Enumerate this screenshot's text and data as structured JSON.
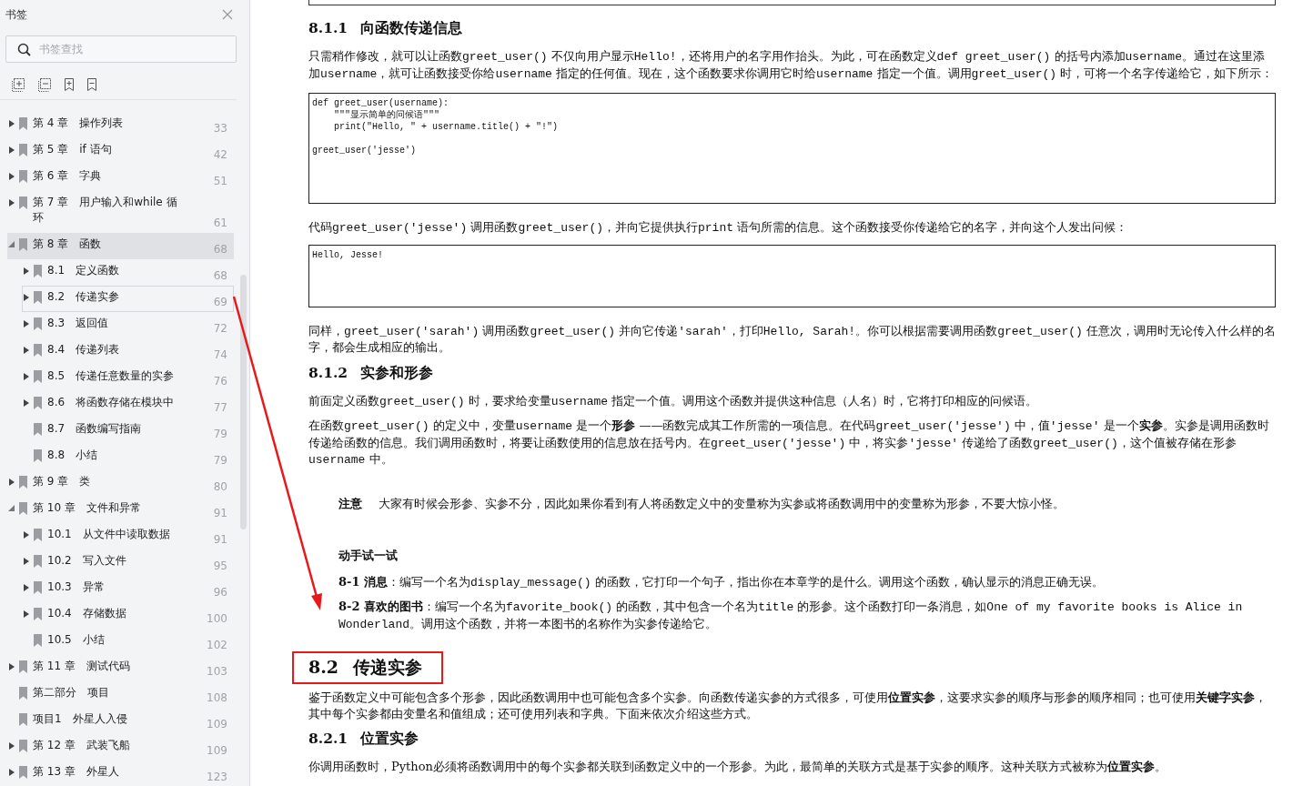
{
  "sidebar": {
    "title": "书签",
    "search": {
      "placeholder": "书签查找"
    },
    "bookmarks": [
      {
        "number": "第 4 章",
        "title": "操作列表",
        "page": "33",
        "expandable": true,
        "expanded": false,
        "selected": false,
        "focused": false
      },
      {
        "number": "第 5 章",
        "title": "if 语句",
        "page": "42",
        "expandable": true,
        "expanded": false,
        "selected": false,
        "focused": false
      },
      {
        "number": "第 6 章",
        "title": "字典",
        "page": "51",
        "expandable": true,
        "expanded": false,
        "selected": false,
        "focused": false
      },
      {
        "number": "第 7 章",
        "title": "用户输入和while 循环",
        "page": "61",
        "expandable": true,
        "expanded": false,
        "selected": false,
        "focused": false
      },
      {
        "number": "第 8 章",
        "title": "函数",
        "page": "68",
        "expandable": true,
        "expanded": true,
        "selected": true,
        "focused": false,
        "children": [
          {
            "number": "8.1",
            "title": "定义函数",
            "page": "68",
            "expandable": true,
            "expanded": false,
            "selected": false,
            "focused": false
          },
          {
            "number": "8.2",
            "title": "传递实参",
            "page": "69",
            "expandable": true,
            "expanded": false,
            "selected": false,
            "focused": true
          },
          {
            "number": "8.3",
            "title": "返回值",
            "page": "72",
            "expandable": true,
            "expanded": false,
            "selected": false,
            "focused": false
          },
          {
            "number": "8.4",
            "title": "传递列表",
            "page": "74",
            "expandable": true,
            "expanded": false,
            "selected": false,
            "focused": false
          },
          {
            "number": "8.5",
            "title": "传递任意数量的实参",
            "page": "76",
            "expandable": true,
            "expanded": false,
            "selected": false,
            "focused": false
          },
          {
            "number": "8.6",
            "title": "将函数存储在模块中",
            "page": "77",
            "expandable": true,
            "expanded": false,
            "selected": false,
            "focused": false
          },
          {
            "number": "8.7",
            "title": "函数编写指南",
            "page": "79",
            "expandable": false,
            "selected": false,
            "focused": false
          },
          {
            "number": "8.8",
            "title": "小结",
            "page": "79",
            "expandable": false,
            "selected": false,
            "focused": false
          }
        ]
      },
      {
        "number": "第 9 章",
        "title": "类",
        "page": "80",
        "expandable": true,
        "expanded": false,
        "selected": false,
        "focused": false
      },
      {
        "number": "第 10 章",
        "title": "文件和异常",
        "page": "91",
        "expandable": true,
        "expanded": true,
        "selected": false,
        "focused": false,
        "children": [
          {
            "number": "10.1",
            "title": "从文件中读取数据",
            "page": "91",
            "expandable": true,
            "expanded": false,
            "selected": false,
            "focused": false
          },
          {
            "number": "10.2",
            "title": "写入文件",
            "page": "95",
            "expandable": true,
            "expanded": false,
            "selected": false,
            "focused": false
          },
          {
            "number": "10.3",
            "title": "异常",
            "page": "96",
            "expandable": true,
            "expanded": false,
            "selected": false,
            "focused": false
          },
          {
            "number": "10.4",
            "title": "存储数据",
            "page": "100",
            "expandable": true,
            "expanded": false,
            "selected": false,
            "focused": false
          },
          {
            "number": "10.5",
            "title": "小结",
            "page": "102",
            "expandable": false,
            "selected": false,
            "focused": false
          }
        ]
      },
      {
        "number": "第 11 章",
        "title": "测试代码",
        "page": "103",
        "expandable": true,
        "expanded": false,
        "selected": false,
        "focused": false
      },
      {
        "number": "第二部分",
        "title": "项目",
        "page": "108",
        "expandable": false,
        "selected": false,
        "focused": false
      },
      {
        "number": "项目1",
        "title": "外星人入侵",
        "page": "109",
        "expandable": false,
        "selected": false,
        "focused": false
      },
      {
        "number": "第 12 章",
        "title": "武装飞船",
        "page": "109",
        "expandable": true,
        "expanded": false,
        "selected": false,
        "focused": false
      },
      {
        "number": "第 13 章",
        "title": "外星人",
        "page": "123",
        "expandable": true,
        "expanded": false,
        "selected": false,
        "focused": false
      }
    ]
  },
  "document": {
    "blocks": [
      {
        "kind": "heading",
        "number": "8.1.1",
        "title": "向函数传递信息",
        "boxed": false
      },
      {
        "kind": "paragraph",
        "runs": [
          {
            "kind": "text",
            "text": "只需稍作修改，就可以让函数"
          },
          {
            "kind": "code",
            "text": "greet_user()"
          },
          {
            "kind": "text",
            "text": " 不仅向用户显示"
          },
          {
            "kind": "code",
            "text": "Hello!"
          },
          {
            "kind": "text",
            "text": "，还将用户的名字用作抬头。为此，可在函数定义"
          },
          {
            "kind": "code",
            "text": "def greet_user()"
          },
          {
            "kind": "text",
            "text": " 的括号内添加"
          },
          {
            "kind": "code",
            "text": "username"
          },
          {
            "kind": "text",
            "text": "。通过在这里添加"
          },
          {
            "kind": "code",
            "text": "username"
          },
          {
            "kind": "text",
            "text": "，就可让函数接受你给"
          },
          {
            "kind": "code",
            "text": "username"
          },
          {
            "kind": "text",
            "text": " 指定的任何值。现在，这个函数要求你调用它时给"
          },
          {
            "kind": "code",
            "text": "username"
          },
          {
            "kind": "text",
            "text": " 指定一个值。调用"
          },
          {
            "kind": "code",
            "text": "greet_user()"
          },
          {
            "kind": "text",
            "text": " 时，可将一个名字传递给它，如下所示："
          }
        ]
      },
      {
        "kind": "code",
        "groups": [
          [
            "def greet_user(username):",
            "    \"\"\"显示简单的问候语\"\"\"",
            "    print(\"Hello, \" + username.title() + \"!\")"
          ],
          [
            "greet_user('jesse')"
          ]
        ]
      },
      {
        "kind": "paragraph",
        "runs": [
          {
            "kind": "text",
            "text": "代码"
          },
          {
            "kind": "code",
            "text": "greet_user('jesse')"
          },
          {
            "kind": "text",
            "text": " 调用函数"
          },
          {
            "kind": "code",
            "text": "greet_user()"
          },
          {
            "kind": "text",
            "text": "，并向它提供执行"
          },
          {
            "kind": "code",
            "text": "print"
          },
          {
            "kind": "text",
            "text": " 语句所需的信息。这个函数接受你传递给它的名字，并向这个人发出问候："
          }
        ]
      },
      {
        "kind": "output",
        "groups": [
          [
            "Hello, Jesse!"
          ]
        ]
      },
      {
        "kind": "paragraph",
        "runs": [
          {
            "kind": "text",
            "text": "同样，"
          },
          {
            "kind": "code",
            "text": "greet_user('sarah')"
          },
          {
            "kind": "text",
            "text": " 调用函数"
          },
          {
            "kind": "code",
            "text": "greet_user()"
          },
          {
            "kind": "text",
            "text": " 并向它传递"
          },
          {
            "kind": "code",
            "text": "'sarah'"
          },
          {
            "kind": "text",
            "text": "，打印"
          },
          {
            "kind": "code",
            "text": "Hello, Sarah!"
          },
          {
            "kind": "text",
            "text": "。你可以根据需要调用函数"
          },
          {
            "kind": "code",
            "text": "greet_user()"
          },
          {
            "kind": "text",
            "text": " 任意次，调用时无论传入什么样的名字，都会生成相应的输出。"
          }
        ]
      },
      {
        "kind": "heading",
        "number": "8.1.2",
        "title": "实参和形参",
        "boxed": false
      },
      {
        "kind": "paragraph",
        "runs": [
          {
            "kind": "text",
            "text": "前面定义函数"
          },
          {
            "kind": "code",
            "text": "greet_user()"
          },
          {
            "kind": "text",
            "text": " 时，要求给变量"
          },
          {
            "kind": "code",
            "text": "username"
          },
          {
            "kind": "text",
            "text": " 指定一个值。调用这个函数并提供这种信息（人名）时，它将打印相应的问候语。"
          }
        ]
      },
      {
        "kind": "paragraph",
        "runs": [
          {
            "kind": "text",
            "text": "在函数"
          },
          {
            "kind": "code",
            "text": "greet_user()"
          },
          {
            "kind": "text",
            "text": " 的定义中，变量"
          },
          {
            "kind": "code",
            "text": "username"
          },
          {
            "kind": "text",
            "text": " 是一个"
          },
          {
            "kind": "bold",
            "text": "形参"
          },
          {
            "kind": "text",
            "text": " ——函数完成其工作所需的一项信息。在代码"
          },
          {
            "kind": "code",
            "text": "greet_user('jesse')"
          },
          {
            "kind": "text",
            "text": " 中，值"
          },
          {
            "kind": "code",
            "text": "'jesse'"
          },
          {
            "kind": "text",
            "text": " 是一个"
          },
          {
            "kind": "bold",
            "text": "实参"
          },
          {
            "kind": "text",
            "text": "。实参是调用函数时传递给函数的信息。我们调用函数时，将要让函数使用的信息放在括号内。在"
          },
          {
            "kind": "code",
            "text": "greet_user('jesse')"
          },
          {
            "kind": "text",
            "text": " 中，将实参"
          },
          {
            "kind": "code",
            "text": "'jesse'"
          },
          {
            "kind": "text",
            "text": " 传递给了函数"
          },
          {
            "kind": "code",
            "text": "greet_user()"
          },
          {
            "kind": "text",
            "text": "，这个值被存储在形参"
          },
          {
            "kind": "code",
            "text": "username"
          },
          {
            "kind": "text",
            "text": " 中。"
          }
        ]
      },
      {
        "kind": "note",
        "label": "注意",
        "text": "大家有时候会形参、实参不分，因此如果你看到有人将函数定义中的变量称为实参或将函数调用中的变量称为形参，不要大惊小怪。"
      },
      {
        "kind": "exercise_title",
        "text": "动手试一试"
      },
      {
        "kind": "exercise",
        "runs": [
          {
            "kind": "bold",
            "text": "8-1 消息"
          },
          {
            "kind": "text",
            "text": "：编写一个名为"
          },
          {
            "kind": "code",
            "text": "display_message()"
          },
          {
            "kind": "text",
            "text": " 的函数，它打印一个句子，指出你在本章学的是什么。调用这个函数，确认显示的消息正确无误。"
          }
        ]
      },
      {
        "kind": "exercise",
        "runs": [
          {
            "kind": "bold",
            "text": "8-2 喜欢的图书"
          },
          {
            "kind": "text",
            "text": "：编写一个名为"
          },
          {
            "kind": "code",
            "text": "favorite_book()"
          },
          {
            "kind": "text",
            "text": " 的函数，其中包含一个名为"
          },
          {
            "kind": "code",
            "text": "title"
          },
          {
            "kind": "text",
            "text": " 的形参。这个函数打印一条消息，如"
          },
          {
            "kind": "code",
            "text": "One of my favorite books is Alice in Wonderland"
          },
          {
            "kind": "text",
            "text": "。调用这个函数，并将一本图书的名称作为实参传递给它。"
          }
        ]
      },
      {
        "kind": "section",
        "number": "8.2",
        "title": "传递实参",
        "boxed": true
      },
      {
        "kind": "paragraph",
        "runs": [
          {
            "kind": "text",
            "text": "鉴于函数定义中可能包含多个形参，因此函数调用中也可能包含多个实参。向函数传递实参的方式很多，可使用"
          },
          {
            "kind": "bold",
            "text": "位置实参"
          },
          {
            "kind": "text",
            "text": "，这要求实参的顺序与形参的顺序相同；也可使用"
          },
          {
            "kind": "bold",
            "text": "关键字实参"
          },
          {
            "kind": "text",
            "text": "，其中每个实参都由变量名和值组成；还可使用列表和字典。下面来依次介绍这些方式。"
          }
        ]
      },
      {
        "kind": "heading",
        "number": "8.2.1",
        "title": "位置实参",
        "boxed": false
      },
      {
        "kind": "paragraph",
        "runs": [
          {
            "kind": "text",
            "text": "你调用函数时，Python必须将函数调用中的每个实参都关联到函数定义中的一个形参。为此，最简单的关联方式是基于实参的顺序。这种关联方式被称为"
          },
          {
            "kind": "bold",
            "text": "位置实参"
          },
          {
            "kind": "text",
            "text": "。"
          }
        ]
      }
    ]
  }
}
